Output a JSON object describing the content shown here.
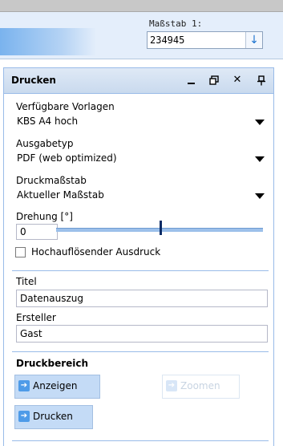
{
  "scale": {
    "label": "Maßstab 1:",
    "value": "234945",
    "button_icon": "arrow-down-icon"
  },
  "panel": {
    "title": "Drucken",
    "tools": {
      "minimize": "_",
      "restore": "🗗",
      "close": "✕",
      "pin": "⊥"
    }
  },
  "form": {
    "templates": {
      "label": "Verfügbare Vorlagen",
      "value": "KBS A4 hoch"
    },
    "output_type": {
      "label": "Ausgabetyp",
      "value": "PDF (web optimized)"
    },
    "print_scale": {
      "label": "Druckmaßstab",
      "value": "Aktueller Maßstab"
    },
    "rotation": {
      "label": "Drehung [°]",
      "value": "0",
      "slider_fraction": 0.5
    },
    "high_res": {
      "label": "Hochauflösender Ausdruck",
      "checked": false
    },
    "title_field": {
      "label": "Titel",
      "value": "Datenauszug"
    },
    "author_field": {
      "label": "Ersteller",
      "value": "Gast"
    }
  },
  "print_area": {
    "title": "Druckbereich",
    "show_label": "Anzeigen",
    "zoom_label": "Zoomen",
    "print_label": "Drucken"
  },
  "colors": {
    "accent": "#99bbe8",
    "button": "#c4dbf6",
    "icon": "#4e9be8"
  }
}
